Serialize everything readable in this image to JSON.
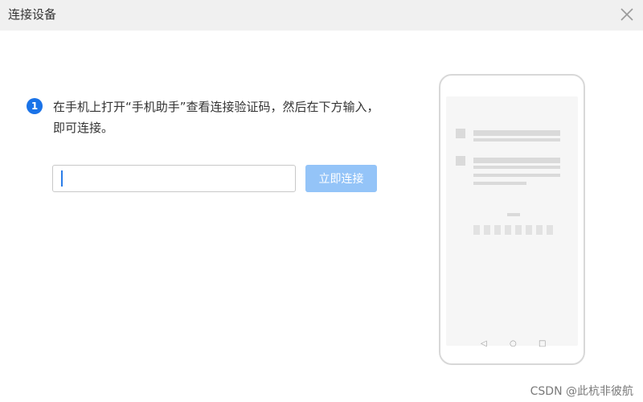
{
  "window": {
    "title": "连接设备",
    "close_icon": "close-icon"
  },
  "step": {
    "number": "1",
    "instruction": "在手机上打开“手机助手”查看连接验证码，然后在下方输入，即可连接。"
  },
  "form": {
    "code_value": "",
    "connect_label": "立即连接"
  },
  "colors": {
    "accent": "#1a73e8",
    "button_disabled": "#94c4f8",
    "titlebar_bg": "#f0f0f0"
  },
  "watermark": "CSDN @此杭非彼航"
}
